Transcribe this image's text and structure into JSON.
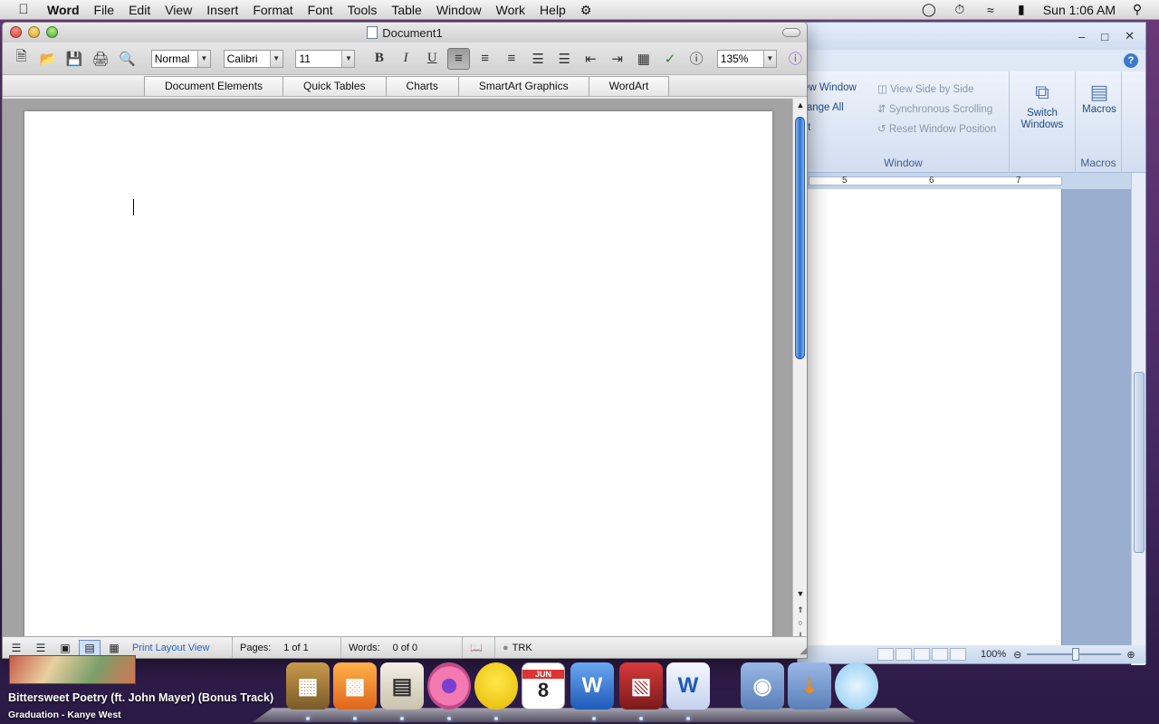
{
  "menubar": {
    "items": [
      "Word",
      "File",
      "Edit",
      "View",
      "Insert",
      "Format",
      "Font",
      "Tools",
      "Table",
      "Window",
      "Work",
      "Help"
    ],
    "clock": "Sun 1:06 AM"
  },
  "window": {
    "title": "Document1",
    "style": "Normal",
    "font": "Calibri",
    "size": "11",
    "zoom": "135%",
    "gallery_tabs": [
      "Document Elements",
      "Quick Tables",
      "Charts",
      "SmartArt Graphics",
      "WordArt"
    ],
    "status": {
      "view_name": "Print Layout View",
      "pages_label": "Pages:",
      "pages_value": "1 of 1",
      "words_label": "Words:",
      "words_value": "0 of 0",
      "trk": "TRK"
    }
  },
  "bgwindow": {
    "items": {
      "new_window": "ew Window",
      "arrange_all": "range All",
      "split": "lit",
      "view_side": "View Side by Side",
      "sync_scroll": "Synchronous Scrolling",
      "reset_pos": "Reset Window Position",
      "switch_windows": "Switch Windows",
      "macros": "Macros"
    },
    "group_window": "Window",
    "group_macros": "Macros",
    "ruler_5": "5",
    "ruler_6": "6",
    "ruler_7": "7",
    "zoom": "100%"
  },
  "itunes": {
    "track": "Bittersweet Poetry (ft. John Mayer) (Bonus Track)",
    "artist": "Graduation - Kanye West"
  },
  "dock": {
    "icons": [
      "app-grid-icon",
      "life-vest-icon",
      "newspaper-icon",
      "donut-icon",
      "rubber-duck-icon",
      "calendar-icon",
      "word-w-icon",
      "parallels-icon",
      "word-doc-icon",
      "mushroom-icon",
      "downloads-icon",
      "fishbowl-icon"
    ],
    "calendar_month": "JUN",
    "calendar_day": "8"
  }
}
